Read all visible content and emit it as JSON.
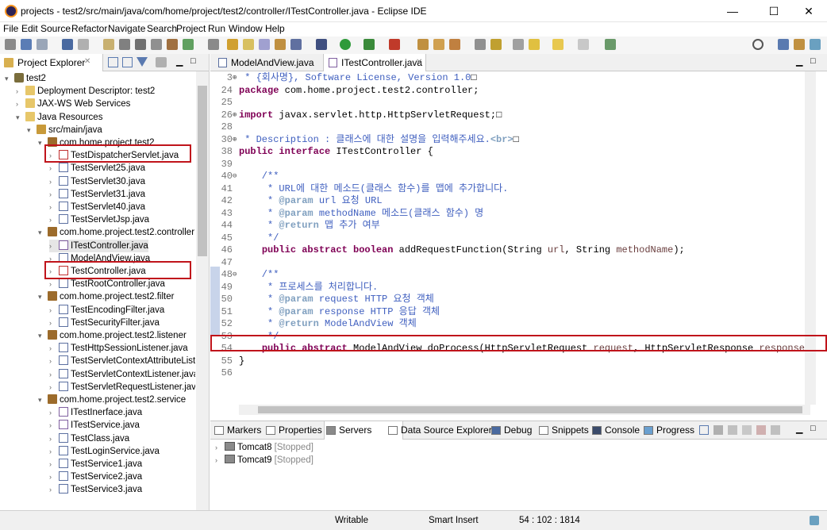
{
  "window": {
    "title": "projects - test2/src/main/java/com/home/project/test2/controller/ITestController.java - Eclipse IDE",
    "minimize": "—",
    "maximize": "☐",
    "close": "✕"
  },
  "menu": [
    "File",
    "Edit",
    "Source",
    "Refactor",
    "Navigate",
    "Search",
    "Project",
    "Run",
    "Window",
    "Help"
  ],
  "project_explorer": {
    "tab_label": "Project Explorer",
    "tab_close": "✕",
    "tree": [
      {
        "label": "test2",
        "level": 0,
        "arrow": "▾",
        "icon": "project-icon"
      },
      {
        "label": "Deployment Descriptor: test2",
        "level": 1,
        "arrow": "›",
        "icon": "deployment-descriptor-icon"
      },
      {
        "label": "JAX-WS Web Services",
        "level": 1,
        "arrow": "›",
        "icon": "web-services-icon"
      },
      {
        "label": "Java Resources",
        "level": 1,
        "arrow": "▾",
        "icon": "java-resources-icon"
      },
      {
        "label": "src/main/java",
        "level": 2,
        "arrow": "▾",
        "icon": "source-folder-icon"
      },
      {
        "label": "com.home.project.test2",
        "level": 3,
        "arrow": "▾",
        "icon": "package-icon"
      },
      {
        "label": "TestDispatcherServlet.java",
        "level": 4,
        "arrow": "›",
        "icon": "java-file-error-icon",
        "highlight": true
      },
      {
        "label": "TestServlet25.java",
        "level": 4,
        "arrow": "›",
        "icon": "java-file-icon"
      },
      {
        "label": "TestServlet30.java",
        "level": 4,
        "arrow": "›",
        "icon": "java-file-icon"
      },
      {
        "label": "TestServlet31.java",
        "level": 4,
        "arrow": "›",
        "icon": "java-file-icon"
      },
      {
        "label": "TestServlet40.java",
        "level": 4,
        "arrow": "›",
        "icon": "java-file-icon"
      },
      {
        "label": "TestServletJsp.java",
        "level": 4,
        "arrow": "›",
        "icon": "java-file-icon"
      },
      {
        "label": "com.home.project.test2.controller",
        "level": 3,
        "arrow": "▾",
        "icon": "package-icon"
      },
      {
        "label": "ITestController.java",
        "level": 4,
        "arrow": "›",
        "icon": "interface-file-icon",
        "selected": true
      },
      {
        "label": "ModelAndView.java",
        "level": 4,
        "arrow": "›",
        "icon": "java-file-icon"
      },
      {
        "label": "TestController.java",
        "level": 4,
        "arrow": "›",
        "icon": "java-file-error-icon",
        "highlight": true
      },
      {
        "label": "TestRootController.java",
        "level": 4,
        "arrow": "›",
        "icon": "java-file-icon"
      },
      {
        "label": "com.home.project.test2.filter",
        "level": 3,
        "arrow": "▾",
        "icon": "package-icon"
      },
      {
        "label": "TestEncodingFilter.java",
        "level": 4,
        "arrow": "›",
        "icon": "java-file-icon"
      },
      {
        "label": "TestSecurityFilter.java",
        "level": 4,
        "arrow": "›",
        "icon": "java-file-icon"
      },
      {
        "label": "com.home.project.test2.listener",
        "level": 3,
        "arrow": "▾",
        "icon": "package-icon"
      },
      {
        "label": "TestHttpSessionListener.java",
        "level": 4,
        "arrow": "›",
        "icon": "java-file-icon"
      },
      {
        "label": "TestServletContextAttributeListe",
        "level": 4,
        "arrow": "›",
        "icon": "java-file-icon"
      },
      {
        "label": "TestServletContextListener.java",
        "level": 4,
        "arrow": "›",
        "icon": "java-file-icon"
      },
      {
        "label": "TestServletRequestListener.java",
        "level": 4,
        "arrow": "›",
        "icon": "java-file-icon"
      },
      {
        "label": "com.home.project.test2.service",
        "level": 3,
        "arrow": "▾",
        "icon": "package-icon"
      },
      {
        "label": "ITestInerface.java",
        "level": 4,
        "arrow": "›",
        "icon": "interface-file-icon"
      },
      {
        "label": "ITestService.java",
        "level": 4,
        "arrow": "›",
        "icon": "interface-file-icon"
      },
      {
        "label": "TestClass.java",
        "level": 4,
        "arrow": "›",
        "icon": "java-file-icon"
      },
      {
        "label": "TestLoginService.java",
        "level": 4,
        "arrow": "›",
        "icon": "java-file-icon"
      },
      {
        "label": "TestService1.java",
        "level": 4,
        "arrow": "›",
        "icon": "java-file-icon"
      },
      {
        "label": "TestService2.java",
        "level": 4,
        "arrow": "›",
        "icon": "java-file-icon"
      },
      {
        "label": "TestService3.java",
        "level": 4,
        "arrow": "›",
        "icon": "java-file-icon"
      }
    ]
  },
  "editor": {
    "tabs": [
      {
        "label": "ModelAndView.java",
        "active": false
      },
      {
        "label": "ITestController.java",
        "active": true,
        "close": "✕"
      }
    ],
    "lines": [
      {
        "n": "3",
        "fold": "⊕",
        "parts": [
          [
            "cm",
            " * {회사명}, Software License, Version 1.0"
          ],
          [
            "",
            "□"
          ]
        ]
      },
      {
        "n": "24",
        "fold": "",
        "parts": [
          [
            "kw",
            "package"
          ],
          [
            "",
            " com.home.project.test2.controller;"
          ]
        ]
      },
      {
        "n": "25",
        "fold": "",
        "parts": []
      },
      {
        "n": "26",
        "fold": "⊕",
        "parts": [
          [
            "kw",
            "import"
          ],
          [
            "",
            " javax.servlet.http.HttpServletRequest;"
          ],
          [
            "",
            "□"
          ]
        ]
      },
      {
        "n": "28",
        "fold": "",
        "parts": []
      },
      {
        "n": "30",
        "fold": "⊕",
        "parts": [
          [
            "cm",
            " * Description : 클래스에 대한 설명을 입력해주세요."
          ],
          [
            "tag",
            "<br>"
          ],
          [
            "",
            "□"
          ]
        ]
      },
      {
        "n": "38",
        "fold": "",
        "parts": [
          [
            "kw",
            "public interface"
          ],
          [
            "",
            " ITestController {"
          ]
        ]
      },
      {
        "n": "39",
        "fold": "",
        "parts": []
      },
      {
        "n": "40",
        "fold": "⊖",
        "parts": [
          [
            "cm",
            "    /**"
          ]
        ]
      },
      {
        "n": "41",
        "fold": "",
        "parts": [
          [
            "cm",
            "     * URL에 대한 메소드(클래스 함수)를 맵에 추가합니다."
          ]
        ]
      },
      {
        "n": "42",
        "fold": "",
        "parts": [
          [
            "cm",
            "     * "
          ],
          [
            "tag",
            "@param"
          ],
          [
            "cm",
            " url 요청 URL"
          ]
        ]
      },
      {
        "n": "43",
        "fold": "",
        "parts": [
          [
            "cm",
            "     * "
          ],
          [
            "tag",
            "@param"
          ],
          [
            "cm",
            " methodName 메소드(클래스 함수) 명"
          ]
        ]
      },
      {
        "n": "44",
        "fold": "",
        "parts": [
          [
            "cm",
            "     * "
          ],
          [
            "tag",
            "@return"
          ],
          [
            "cm",
            " 맵 추가 여부"
          ]
        ]
      },
      {
        "n": "45",
        "fold": "",
        "parts": [
          [
            "cm",
            "     */"
          ]
        ]
      },
      {
        "n": "46",
        "fold": "",
        "parts": [
          [
            "",
            "    "
          ],
          [
            "kw",
            "public abstract boolean"
          ],
          [
            "",
            " addRequestFunction(String "
          ],
          [
            "var",
            "url"
          ],
          [
            "",
            ", String "
          ],
          [
            "var",
            "methodName"
          ],
          [
            "",
            ");"
          ]
        ]
      },
      {
        "n": "47",
        "fold": "",
        "parts": []
      },
      {
        "n": "48",
        "fold": "⊖",
        "parts": [
          [
            "cm",
            "    /**"
          ]
        ]
      },
      {
        "n": "49",
        "fold": "",
        "parts": [
          [
            "cm",
            "     * 프로세스를 처리합니다."
          ]
        ]
      },
      {
        "n": "50",
        "fold": "",
        "parts": [
          [
            "cm",
            "     * "
          ],
          [
            "tag",
            "@param"
          ],
          [
            "cm",
            " request HTTP 요청 객체"
          ]
        ]
      },
      {
        "n": "51",
        "fold": "",
        "parts": [
          [
            "cm",
            "     * "
          ],
          [
            "tag",
            "@param"
          ],
          [
            "cm",
            " response HTTP 응답 객체"
          ]
        ]
      },
      {
        "n": "52",
        "fold": "",
        "parts": [
          [
            "cm",
            "     * "
          ],
          [
            "tag",
            "@return"
          ],
          [
            "cm",
            " ModelAndView 객체"
          ]
        ]
      },
      {
        "n": "53",
        "fold": "",
        "parts": [
          [
            "cm",
            "     */"
          ]
        ]
      },
      {
        "n": "54",
        "fold": "",
        "parts": [
          [
            "",
            "    "
          ],
          [
            "kw",
            "public abstract"
          ],
          [
            "",
            " ModelAndView doProcess(HttpServletRequest "
          ],
          [
            "var",
            "request"
          ],
          [
            "",
            ", HttpServletResponse "
          ],
          [
            "var",
            "response"
          ],
          [
            "",
            ");"
          ]
        ]
      },
      {
        "n": "55",
        "fold": "",
        "parts": [
          [
            "",
            "}"
          ]
        ]
      },
      {
        "n": "56",
        "fold": "",
        "parts": []
      }
    ]
  },
  "bottom_panel": {
    "tabs": [
      "Markers",
      "Properties",
      "Servers",
      "Data Source Explorer",
      "Debug",
      "Snippets",
      "Console",
      "Progress"
    ],
    "active_tab": "Servers",
    "servers": [
      {
        "name": "Tomcat8",
        "status": "[Stopped]"
      },
      {
        "name": "Tomcat9",
        "status": "[Stopped]"
      }
    ]
  },
  "status_bar": {
    "mode": "Writable",
    "insert": "Smart Insert",
    "position": "54 : 102 : 1814"
  },
  "colors": {
    "highlight_box": "#c0141b",
    "keyword": "#7f0055",
    "comment": "#3f5fbf",
    "javadoc_tag": "#7f9fbf"
  }
}
